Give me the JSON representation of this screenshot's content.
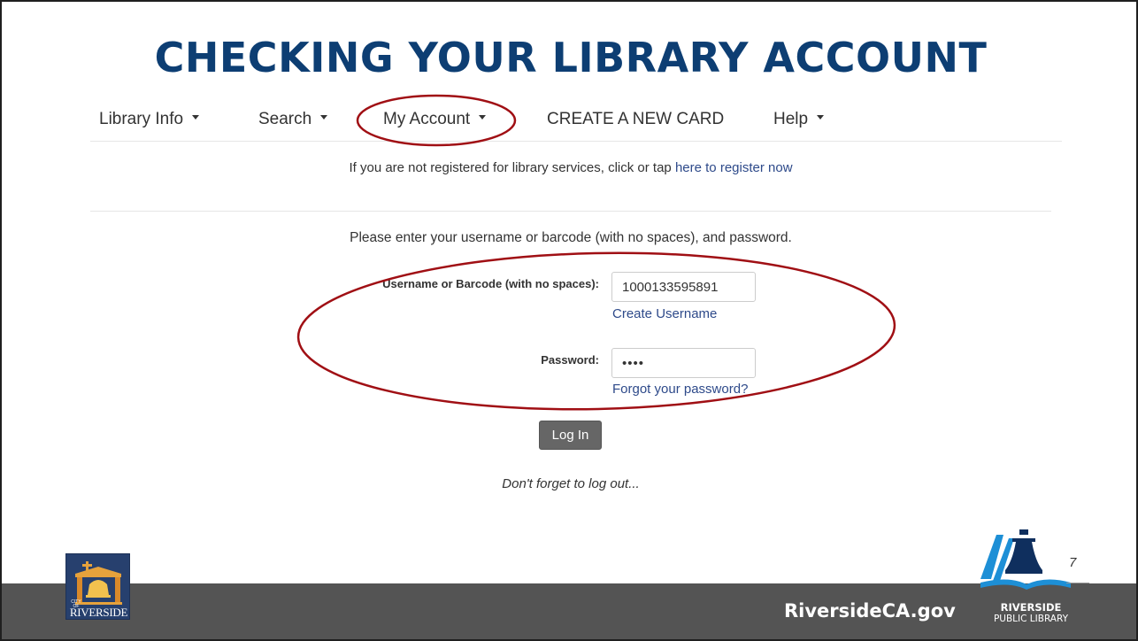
{
  "slide": {
    "title": "CHECKING YOUR LIBRARY ACCOUNT",
    "slide_number": "7"
  },
  "nav": {
    "items": [
      {
        "label": "Library Info",
        "has_dropdown": true
      },
      {
        "label": "Search",
        "has_dropdown": true
      },
      {
        "label": "My Account",
        "has_dropdown": true,
        "highlighted": true
      },
      {
        "label": "CREATE A NEW CARD",
        "has_dropdown": false
      },
      {
        "label": "Help",
        "has_dropdown": true
      }
    ]
  },
  "register_notice": {
    "text": "If you are not registered for library services, click or tap ",
    "link": "here to register now"
  },
  "login": {
    "instructions": "Please enter your username or barcode (with no spaces), and password.",
    "username_label": "Username or Barcode (with no spaces):",
    "username_value": "1000133595891",
    "create_username_link": "Create Username",
    "password_label": "Password:",
    "password_value": "••••",
    "forgot_password_link": "Forgot your password?",
    "login_button": "Log In",
    "logout_note": "Don't forget to log out..."
  },
  "footer": {
    "site": "RiversideCA.gov",
    "city_logo_small": "CITY OF",
    "city_logo_text": "RIVERSIDE",
    "library_name_line1": "RIVERSIDE",
    "library_name_line2": "PUBLIC LIBRARY"
  },
  "colors": {
    "title": "#0d3e73",
    "link": "#2e4a8a",
    "annotation": "#a00f14",
    "footer_bar": "#545454",
    "button": "#666666",
    "library_logo_blue": "#1d8fd6",
    "library_logo_navy": "#0f2f5e"
  },
  "icons": {
    "dropdown": "caret-down-icon",
    "city_logo": "bell-tower-logo",
    "library_logo": "bell-book-logo"
  }
}
